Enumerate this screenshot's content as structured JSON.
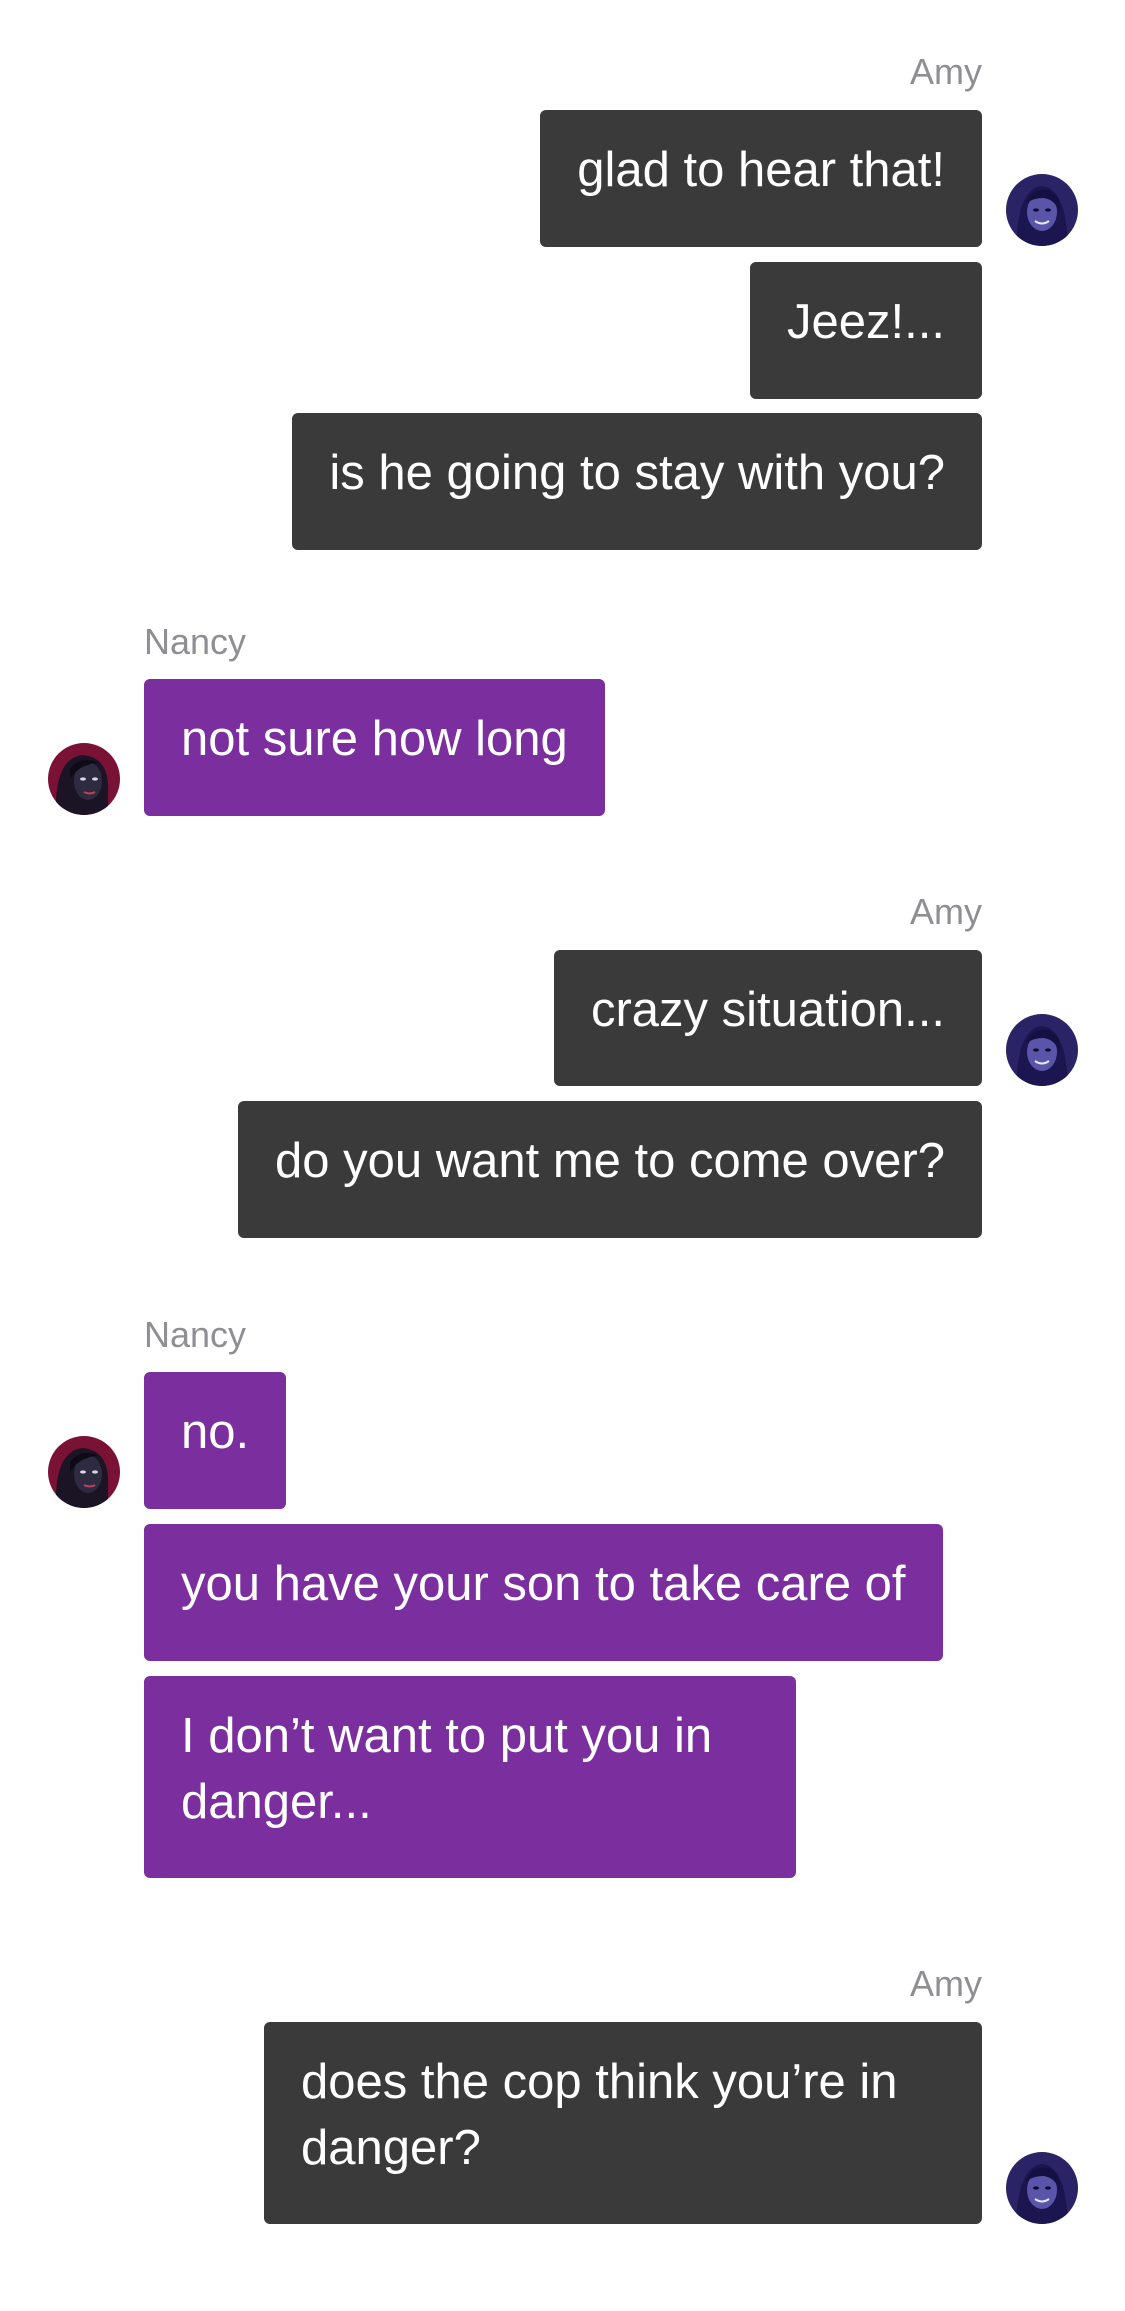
{
  "conversation": {
    "groups": [
      {
        "side": "right",
        "sender": "Amy",
        "messages": [
          "glad to hear that!",
          "Jeez!...",
          "is he going to stay with you?"
        ]
      },
      {
        "side": "left",
        "sender": "Nancy",
        "messages": [
          "not sure how long"
        ]
      },
      {
        "side": "right",
        "sender": "Amy",
        "messages": [
          "crazy situation...",
          "do you want me to come over?"
        ]
      },
      {
        "side": "left",
        "sender": "Nancy",
        "messages": [
          "no.",
          "you have your son to take care of",
          "I don’t want to put you in danger..."
        ]
      },
      {
        "side": "right",
        "sender": "Amy",
        "messages": [
          "does the cop think you’re in danger?"
        ]
      }
    ]
  },
  "colors": {
    "amy_bubble": "#3a3a3a",
    "nancy_bubble": "#7b2f9e",
    "sender_label": "#8e8e93",
    "background": "#ffffff"
  },
  "icons": {
    "amy_avatar": "amy-avatar-icon",
    "nancy_avatar": "nancy-avatar-icon"
  }
}
